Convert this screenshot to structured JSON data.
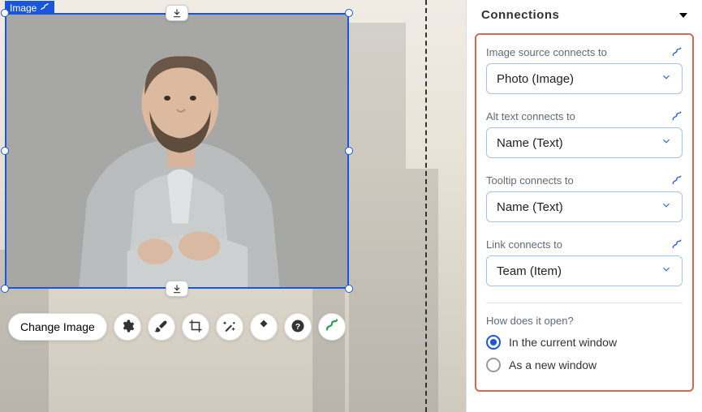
{
  "selection": {
    "label": "Image"
  },
  "toolbar": {
    "change_image": "Change Image"
  },
  "panel": {
    "title": "Connections",
    "groups": [
      {
        "label": "Image source connects to",
        "value": "Photo (Image)"
      },
      {
        "label": "Alt text connects to",
        "value": "Name (Text)"
      },
      {
        "label": "Tooltip connects to",
        "value": "Name (Text)"
      },
      {
        "label": "Link connects to",
        "value": "Team (Item)"
      }
    ],
    "open_label": "How does it open?",
    "open_options": [
      {
        "label": "In the current window",
        "selected": true
      },
      {
        "label": "As a new window",
        "selected": false
      }
    ]
  }
}
